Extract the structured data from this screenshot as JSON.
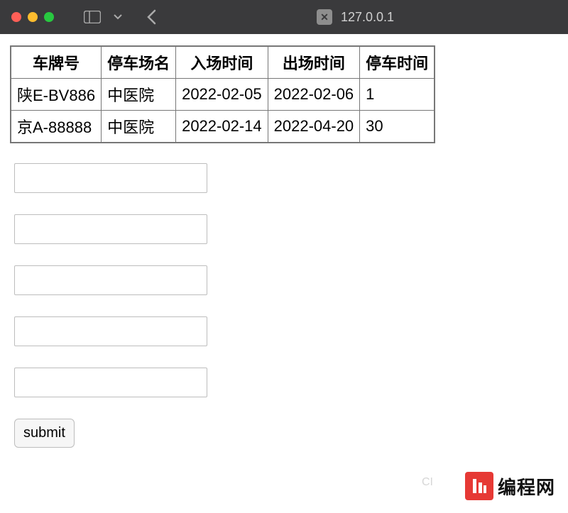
{
  "titlebar": {
    "url": "127.0.0.1"
  },
  "table": {
    "headers": [
      "车牌号",
      "停车场名",
      "入场时间",
      "出场时间",
      "停车时间"
    ],
    "rows": [
      [
        "陕E-BV886",
        "中医院",
        "2022-02-05",
        "2022-02-06",
        "1"
      ],
      [
        "京A-88888",
        "中医院",
        "2022-02-14",
        "2022-04-20",
        "30"
      ]
    ]
  },
  "form": {
    "submit_label": "submit"
  },
  "watermark": {
    "text": "编程网",
    "reader": "CI"
  }
}
